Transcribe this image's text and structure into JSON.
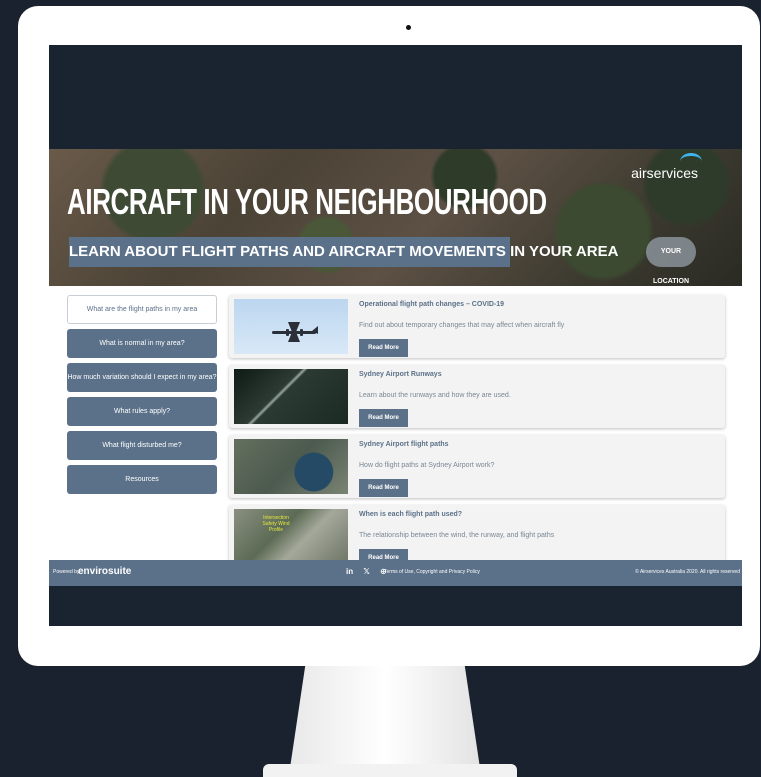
{
  "banner": {
    "title": "AIRCRAFT IN YOUR NEIGHBOURHOOD",
    "subtitle": "LEARN ABOUT FLIGHT PATHS AND AIRCRAFT MOVEMENTS IN YOUR AREA",
    "brand": "airservices",
    "location_button": "YOUR LOCATION"
  },
  "nav": {
    "items": [
      {
        "label": "What are the flight paths in my area"
      },
      {
        "label": "What is normal in my area?"
      },
      {
        "label": "How much variation should I expect in my area?"
      },
      {
        "label": "What rules apply?"
      },
      {
        "label": "What flight disturbed me?"
      },
      {
        "label": "Resources"
      }
    ]
  },
  "cards": [
    {
      "title": "Operational flight path changes – COVID-19",
      "description": "Find out about temporary changes that may affect when aircraft fly",
      "button": "Read More"
    },
    {
      "title": "Sydney Airport Runways",
      "description": "Learn about the runways and how they are used.",
      "button": "Read More"
    },
    {
      "title": "Sydney Airport flight paths",
      "description": "How do flight paths at Sydney Airport work?",
      "button": "Read More"
    },
    {
      "title": "When is each flight path used?",
      "description": "The relationship between the wind, the runway, and flight paths",
      "button": "Read More",
      "thumb_label": "Intersection Safety Wind Profile"
    }
  ],
  "footer": {
    "powered_by": "Powered by",
    "logo": "envirosuite",
    "socials": [
      "in",
      "𝕏",
      "⊕"
    ],
    "terms": "Terms of Use, Copyright and Privacy Policy",
    "copyright": "© Airservices Australia 2020. All rights reserved"
  },
  "colors": {
    "accent": "#5b7189",
    "background": "#19222e",
    "brand_swoosh": "#3fb5ea"
  }
}
